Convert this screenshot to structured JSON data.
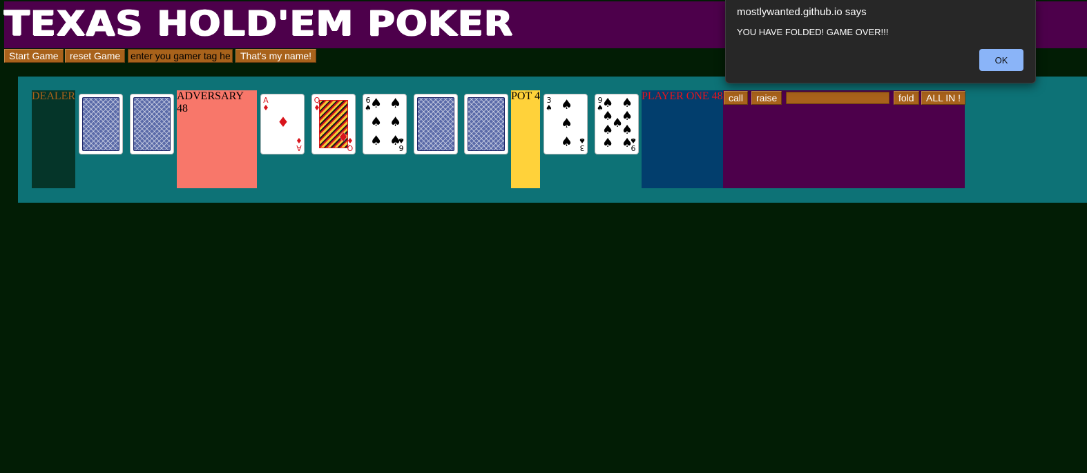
{
  "header": {
    "title": "TEXAS HOLD'EM POKER"
  },
  "controls": {
    "start_label": "Start Game",
    "reset_label": "reset Game",
    "gamer_tag_placeholder": "enter you gamer tag here",
    "name_label": "That's my name!"
  },
  "table": {
    "dealer_label": "DEALER",
    "adversary_label": "ADVERSARY 48",
    "pot_label": "POT 4",
    "player_label": "PLAYER ONE 48",
    "dealer_cards": [
      "card-back",
      "card-back"
    ],
    "community_cards": [
      {
        "rank": "A",
        "suit": "♦",
        "color": "#d8141c"
      },
      {
        "rank": "Q",
        "suit": "♦",
        "color": "#d8141c"
      },
      {
        "rank": "6",
        "suit": "♠",
        "color": "#000000"
      },
      {
        "face": "card-back"
      },
      {
        "face": "card-back"
      }
    ],
    "player_cards": [
      {
        "rank": "3",
        "suit": "♠",
        "color": "#000000"
      },
      {
        "rank": "9",
        "suit": "♠",
        "color": "#000000"
      }
    ]
  },
  "actions": {
    "call_label": "call",
    "raise_label": "raise",
    "bet_placeholder": "",
    "fold_label": "fold",
    "allin_label": "ALL IN !"
  },
  "dialog": {
    "host": "mostlywanted.github.io says",
    "message": "YOU HAVE FOLDED! GAME OVER!!!",
    "ok_label": "OK"
  },
  "colors": {
    "background": "#021d05",
    "header": "#4d004b",
    "table": "#0d7276",
    "button": "#a8621b",
    "dealer_zone": "#053529",
    "adversary_zone": "#f8776a",
    "pot_zone": "#ffd23a",
    "player_zone": "#023e6d",
    "actions_zone": "#4d004b",
    "dialog_button": "#8ab4f8"
  }
}
